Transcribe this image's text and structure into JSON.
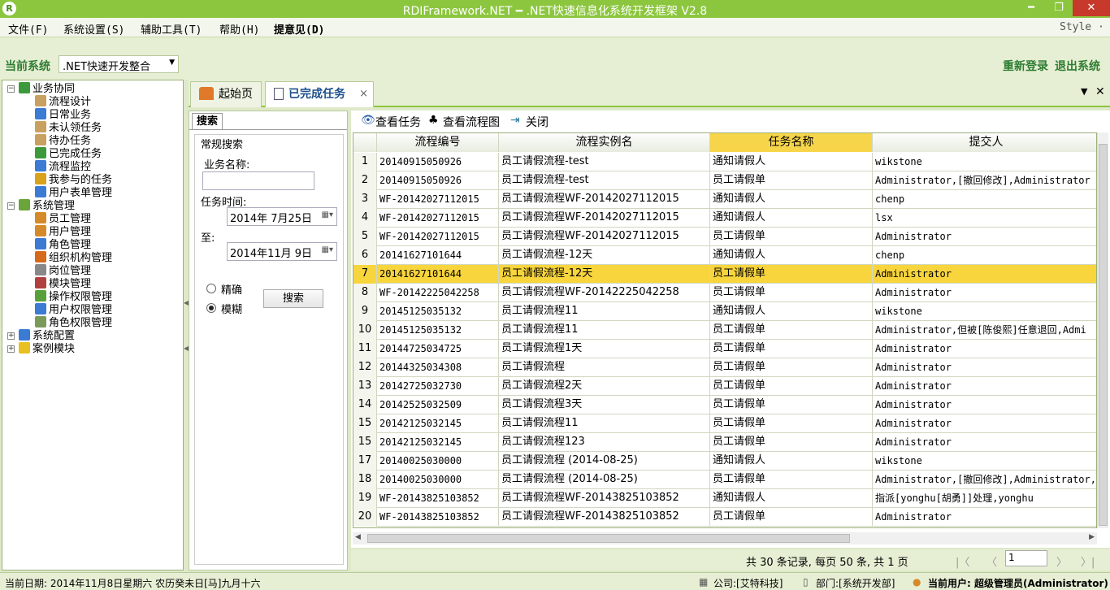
{
  "window": {
    "title": "RDIFramework.NET ━ .NET快速信息化系统开发框架 V2.8",
    "logo": "R",
    "min": "━",
    "restore": "❐",
    "close": "✕"
  },
  "menu": {
    "items": [
      "文件(F)",
      "系统设置(S)",
      "辅助工具(T)",
      "帮助(H)",
      "提意见(D)"
    ],
    "style_label": "Style ·"
  },
  "system": {
    "label": "当前系统",
    "value": ".NET快速开发整合",
    "relogin": "重新登录",
    "exit": "退出系统"
  },
  "tree": [
    {
      "label": "业务协同",
      "level": 0,
      "icon_color": "#3c9a3c",
      "icon": "sync-icon",
      "expander": "−"
    },
    {
      "label": "流程设计",
      "level": 1,
      "icon_color": "#c8a060",
      "icon": "flow-design-icon"
    },
    {
      "label": "日常业务",
      "level": 1,
      "icon_color": "#3b7bd4",
      "icon": "daily-business-icon"
    },
    {
      "label": "未认领任务",
      "level": 1,
      "icon_color": "#c8a060",
      "icon": "unclaimed-task-icon"
    },
    {
      "label": "待办任务",
      "level": 1,
      "icon_color": "#c8a060",
      "icon": "todo-task-icon"
    },
    {
      "label": "已完成任务",
      "level": 1,
      "icon_color": "#3c9a3c",
      "icon": "completed-task-icon"
    },
    {
      "label": "流程监控",
      "level": 1,
      "icon_color": "#3b7bd4",
      "icon": "eye-icon"
    },
    {
      "label": "我参与的任务",
      "level": 1,
      "icon_color": "#d9a21b",
      "icon": "participated-task-icon"
    },
    {
      "label": "用户表单管理",
      "level": 1,
      "icon_color": "#3b7bd4",
      "icon": "form-icon"
    },
    {
      "label": "系统管理",
      "level": 0,
      "icon_color": "#6aa43a",
      "icon": "system-icon",
      "expander": "−"
    },
    {
      "label": "员工管理",
      "level": 1,
      "icon_color": "#d58a2a",
      "icon": "staff-icon"
    },
    {
      "label": "用户管理",
      "level": 1,
      "icon_color": "#d58a2a",
      "icon": "users-icon"
    },
    {
      "label": "角色管理",
      "level": 1,
      "icon_color": "#3b7bd4",
      "icon": "role-icon"
    },
    {
      "label": "组织机构管理",
      "level": 1,
      "icon_color": "#d56a1a",
      "icon": "org-icon"
    },
    {
      "label": "岗位管理",
      "level": 1,
      "icon_color": "#888888",
      "icon": "post-icon"
    },
    {
      "label": "模块管理",
      "level": 1,
      "icon_color": "#b04040",
      "icon": "module-icon"
    },
    {
      "label": "操作权限管理",
      "level": 1,
      "icon_color": "#5aa03a",
      "icon": "operation-permission-icon"
    },
    {
      "label": "用户权限管理",
      "level": 1,
      "icon_color": "#3b7bd4",
      "icon": "user-permission-icon"
    },
    {
      "label": "角色权限管理",
      "level": 1,
      "icon_color": "#7a9a5a",
      "icon": "role-permission-icon"
    },
    {
      "label": "系统配置",
      "level": 0,
      "icon_color": "#3b7bd4",
      "icon": "config-icon",
      "expander": "+"
    },
    {
      "label": "案例模块",
      "level": 0,
      "icon_color": "#e8c020",
      "icon": "bulb-icon",
      "expander": "+"
    }
  ],
  "tabs": [
    {
      "label": "起始页",
      "icon": "home-icon"
    },
    {
      "label": "已完成任务",
      "icon": "doc-icon",
      "close": "×"
    }
  ],
  "tabstrip_controls": {
    "menu": "▼",
    "close": "✕"
  },
  "search": {
    "tab": "搜索",
    "group": "常规搜索",
    "biz_label": "业务名称:",
    "biz_value": "",
    "time_label": "任务时间:",
    "from": "2014年 7月25日",
    "to_label": "至:",
    "to": "2014年11月 9日",
    "exact": "精确",
    "fuzzy": "模糊",
    "button": "搜索"
  },
  "toolbar": {
    "view_task": "查看任务",
    "view_flow": "查看流程图",
    "close": "关闭"
  },
  "grid": {
    "columns": [
      "流程编号",
      "流程实例名",
      "任务名称",
      "提交人"
    ],
    "selected_column": 2,
    "highlight_row": 6,
    "rows": [
      [
        "1",
        "20140915050926",
        "员工请假流程-test",
        "通知请假人",
        "wikstone"
      ],
      [
        "2",
        "20140915050926",
        "员工请假流程-test",
        "员工请假单",
        "Administrator,[撤回修改],Administrator"
      ],
      [
        "3",
        "WF-20142027112015",
        "员工请假流程WF-20142027112015",
        "通知请假人",
        "chenp"
      ],
      [
        "4",
        "WF-20142027112015",
        "员工请假流程WF-20142027112015",
        "通知请假人",
        "lsx"
      ],
      [
        "5",
        "WF-20142027112015",
        "员工请假流程WF-20142027112015",
        "员工请假单",
        "Administrator"
      ],
      [
        "6",
        "20141627101644",
        "员工请假流程-12天",
        "通知请假人",
        "chenp"
      ],
      [
        "7",
        "20141627101644",
        "员工请假流程-12天",
        "员工请假单",
        "Administrator"
      ],
      [
        "8",
        "WF-20142225042258",
        "员工请假流程WF-20142225042258",
        "员工请假单",
        "Administrator"
      ],
      [
        "9",
        "20145125035132",
        "员工请假流程11",
        "通知请假人",
        "wikstone"
      ],
      [
        "10",
        "20145125035132",
        "员工请假流程11",
        "员工请假单",
        "Administrator,但被[陈俊熙]任意退回,Admi"
      ],
      [
        "11",
        "20144725034725",
        "员工请假流程1天",
        "员工请假单",
        "Administrator"
      ],
      [
        "12",
        "20144325034308",
        "员工请假流程",
        "员工请假单",
        "Administrator"
      ],
      [
        "13",
        "20142725032730",
        "员工请假流程2天",
        "员工请假单",
        "Administrator"
      ],
      [
        "14",
        "20142525032509",
        "员工请假流程3天",
        "员工请假单",
        "Administrator"
      ],
      [
        "15",
        "20142125032145",
        "员工请假流程11",
        "员工请假单",
        "Administrator"
      ],
      [
        "15",
        "20142125032145",
        "员工请假流程123",
        "员工请假单",
        "Administrator"
      ],
      [
        "17",
        "20140025030000",
        "员工请假流程 (2014-08-25)",
        "通知请假人",
        "wikstone"
      ],
      [
        "18",
        "20140025030000",
        "员工请假流程 (2014-08-25)",
        "员工请假单",
        "Administrator,[撤回修改],Administrator,"
      ],
      [
        "19",
        "WF-20143825103852",
        "员工请假流程WF-20143825103852",
        "通知请假人",
        "指派[yonghu[胡勇]]处理,yonghu"
      ],
      [
        "20",
        "WF-20143825103852",
        "员工请假流程WF-20143825103852",
        "员工请假单",
        "Administrator"
      ]
    ]
  },
  "pager": {
    "summary": "共 30 条记录, 每页 50 条, 共 1 页",
    "page": "1",
    "first": "|〈",
    "prev": "〈",
    "next": "〉",
    "last": "〉|"
  },
  "status": {
    "date": "当前日期: 2014年11月8日星期六 农历癸未日[马]九月十六",
    "company": "公司:[艾特科技]",
    "dept": "部门:[系统开发部]",
    "user": "当前用户: 超级管理员(Administrator)"
  }
}
